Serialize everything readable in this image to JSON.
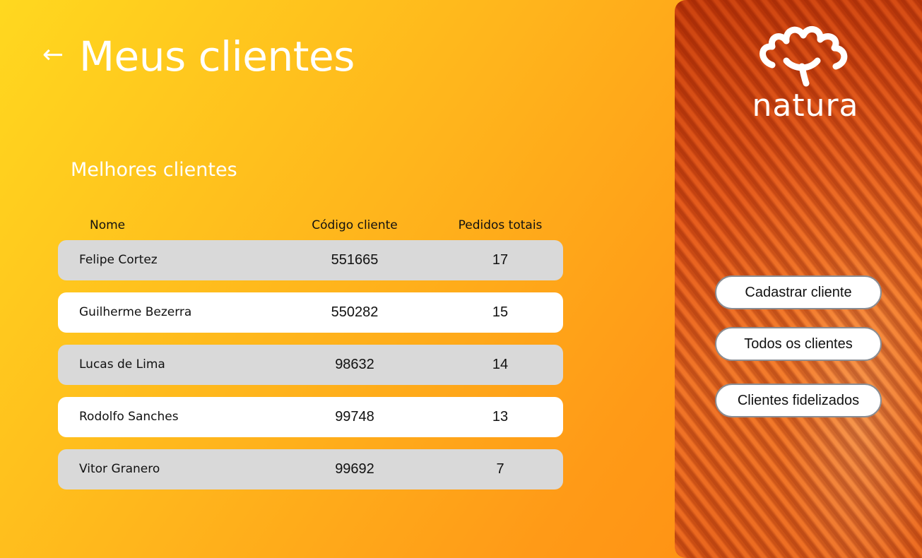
{
  "header": {
    "back_icon": "arrow-left-icon",
    "back_glyph": "←",
    "title": "Meus clientes"
  },
  "section": {
    "title": "Melhores clientes"
  },
  "table": {
    "columns": [
      "Nome",
      "Código cliente",
      "Pedidos totais"
    ],
    "rows": [
      {
        "name": "Felipe Cortez",
        "code": "551665",
        "orders": "17"
      },
      {
        "name": "Guilherme Bezerra",
        "code": "550282",
        "orders": "15"
      },
      {
        "name": "Lucas de Lima",
        "code": "98632",
        "orders": "14"
      },
      {
        "name": "Rodolfo Sanches",
        "code": "99748",
        "orders": "13"
      },
      {
        "name": "Vitor Granero",
        "code": "99692",
        "orders": "7"
      }
    ]
  },
  "sidebar": {
    "brand": "natura",
    "buttons": [
      {
        "label": "Cadastrar cliente"
      },
      {
        "label": "Todos os clientes"
      },
      {
        "label": "Clientes fidelizados"
      }
    ]
  },
  "colors": {
    "background_start": "#ffd81f",
    "background_end": "#ff8a10",
    "row_gray": "#d9d9d9",
    "row_white": "#ffffff",
    "button_border": "#8a8d93",
    "sidebar_orange": "#e4581a"
  }
}
